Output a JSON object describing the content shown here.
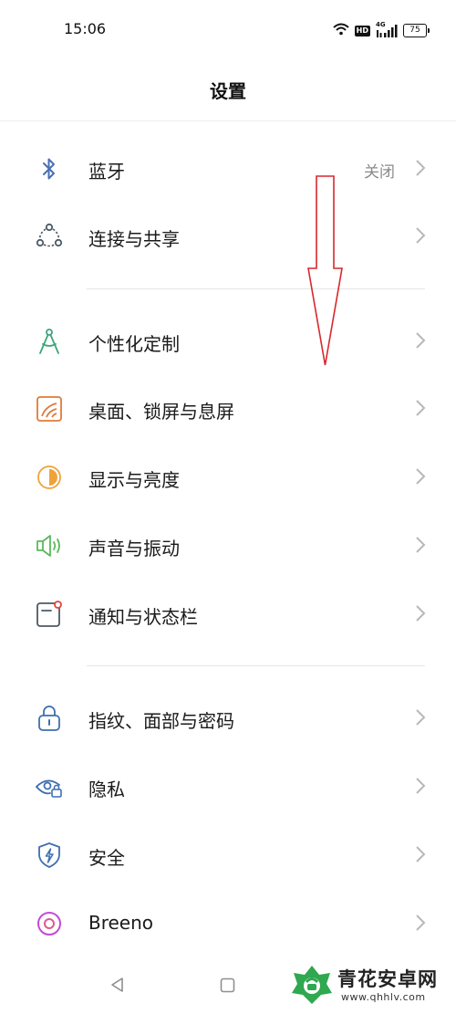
{
  "status_bar": {
    "time": "15:06",
    "network_label": "4G",
    "battery": "75",
    "hd_label": "HD"
  },
  "header": {
    "title": "设置"
  },
  "settings": [
    {
      "label": "蓝牙",
      "value": "关闭",
      "icon": "bluetooth-icon",
      "icon_color": "#4a6fb5"
    },
    {
      "label": "连接与共享",
      "icon": "connection-share-icon",
      "icon_color": "#4d5966"
    },
    {
      "label": "个性化定制",
      "icon": "compass-icon",
      "icon_color": "#3aa57a"
    },
    {
      "label": "桌面、锁屏与息屏",
      "icon": "wallpaper-icon",
      "icon_color": "#e07a3c"
    },
    {
      "label": "显示与亮度",
      "icon": "brightness-icon",
      "icon_color": "#f0a23a"
    },
    {
      "label": "声音与振动",
      "icon": "speaker-icon",
      "icon_color": "#5cb85c"
    },
    {
      "label": "通知与状态栏",
      "icon": "notification-icon",
      "icon_color": "#4d5966"
    },
    {
      "label": "指纹、面部与密码",
      "icon": "lock-icon",
      "icon_color": "#3f6fb0"
    },
    {
      "label": "隐私",
      "icon": "privacy-eye-icon",
      "icon_color": "#3f6fb0"
    },
    {
      "label": "安全",
      "icon": "security-shield-icon",
      "icon_color": "#3f6fb0"
    },
    {
      "label": "Breeno",
      "icon": "breeno-icon",
      "icon_color": "#c24bd6"
    }
  ],
  "annotation": {
    "arrow_color": "#d9272e"
  },
  "watermark": {
    "text": "青花安卓网",
    "url": "www.qhhlv.com"
  },
  "colors": {
    "accent_blue": "#4a6fb5",
    "value_gray": "#8a8a8a",
    "chevron_gray": "#b8b8b8"
  }
}
